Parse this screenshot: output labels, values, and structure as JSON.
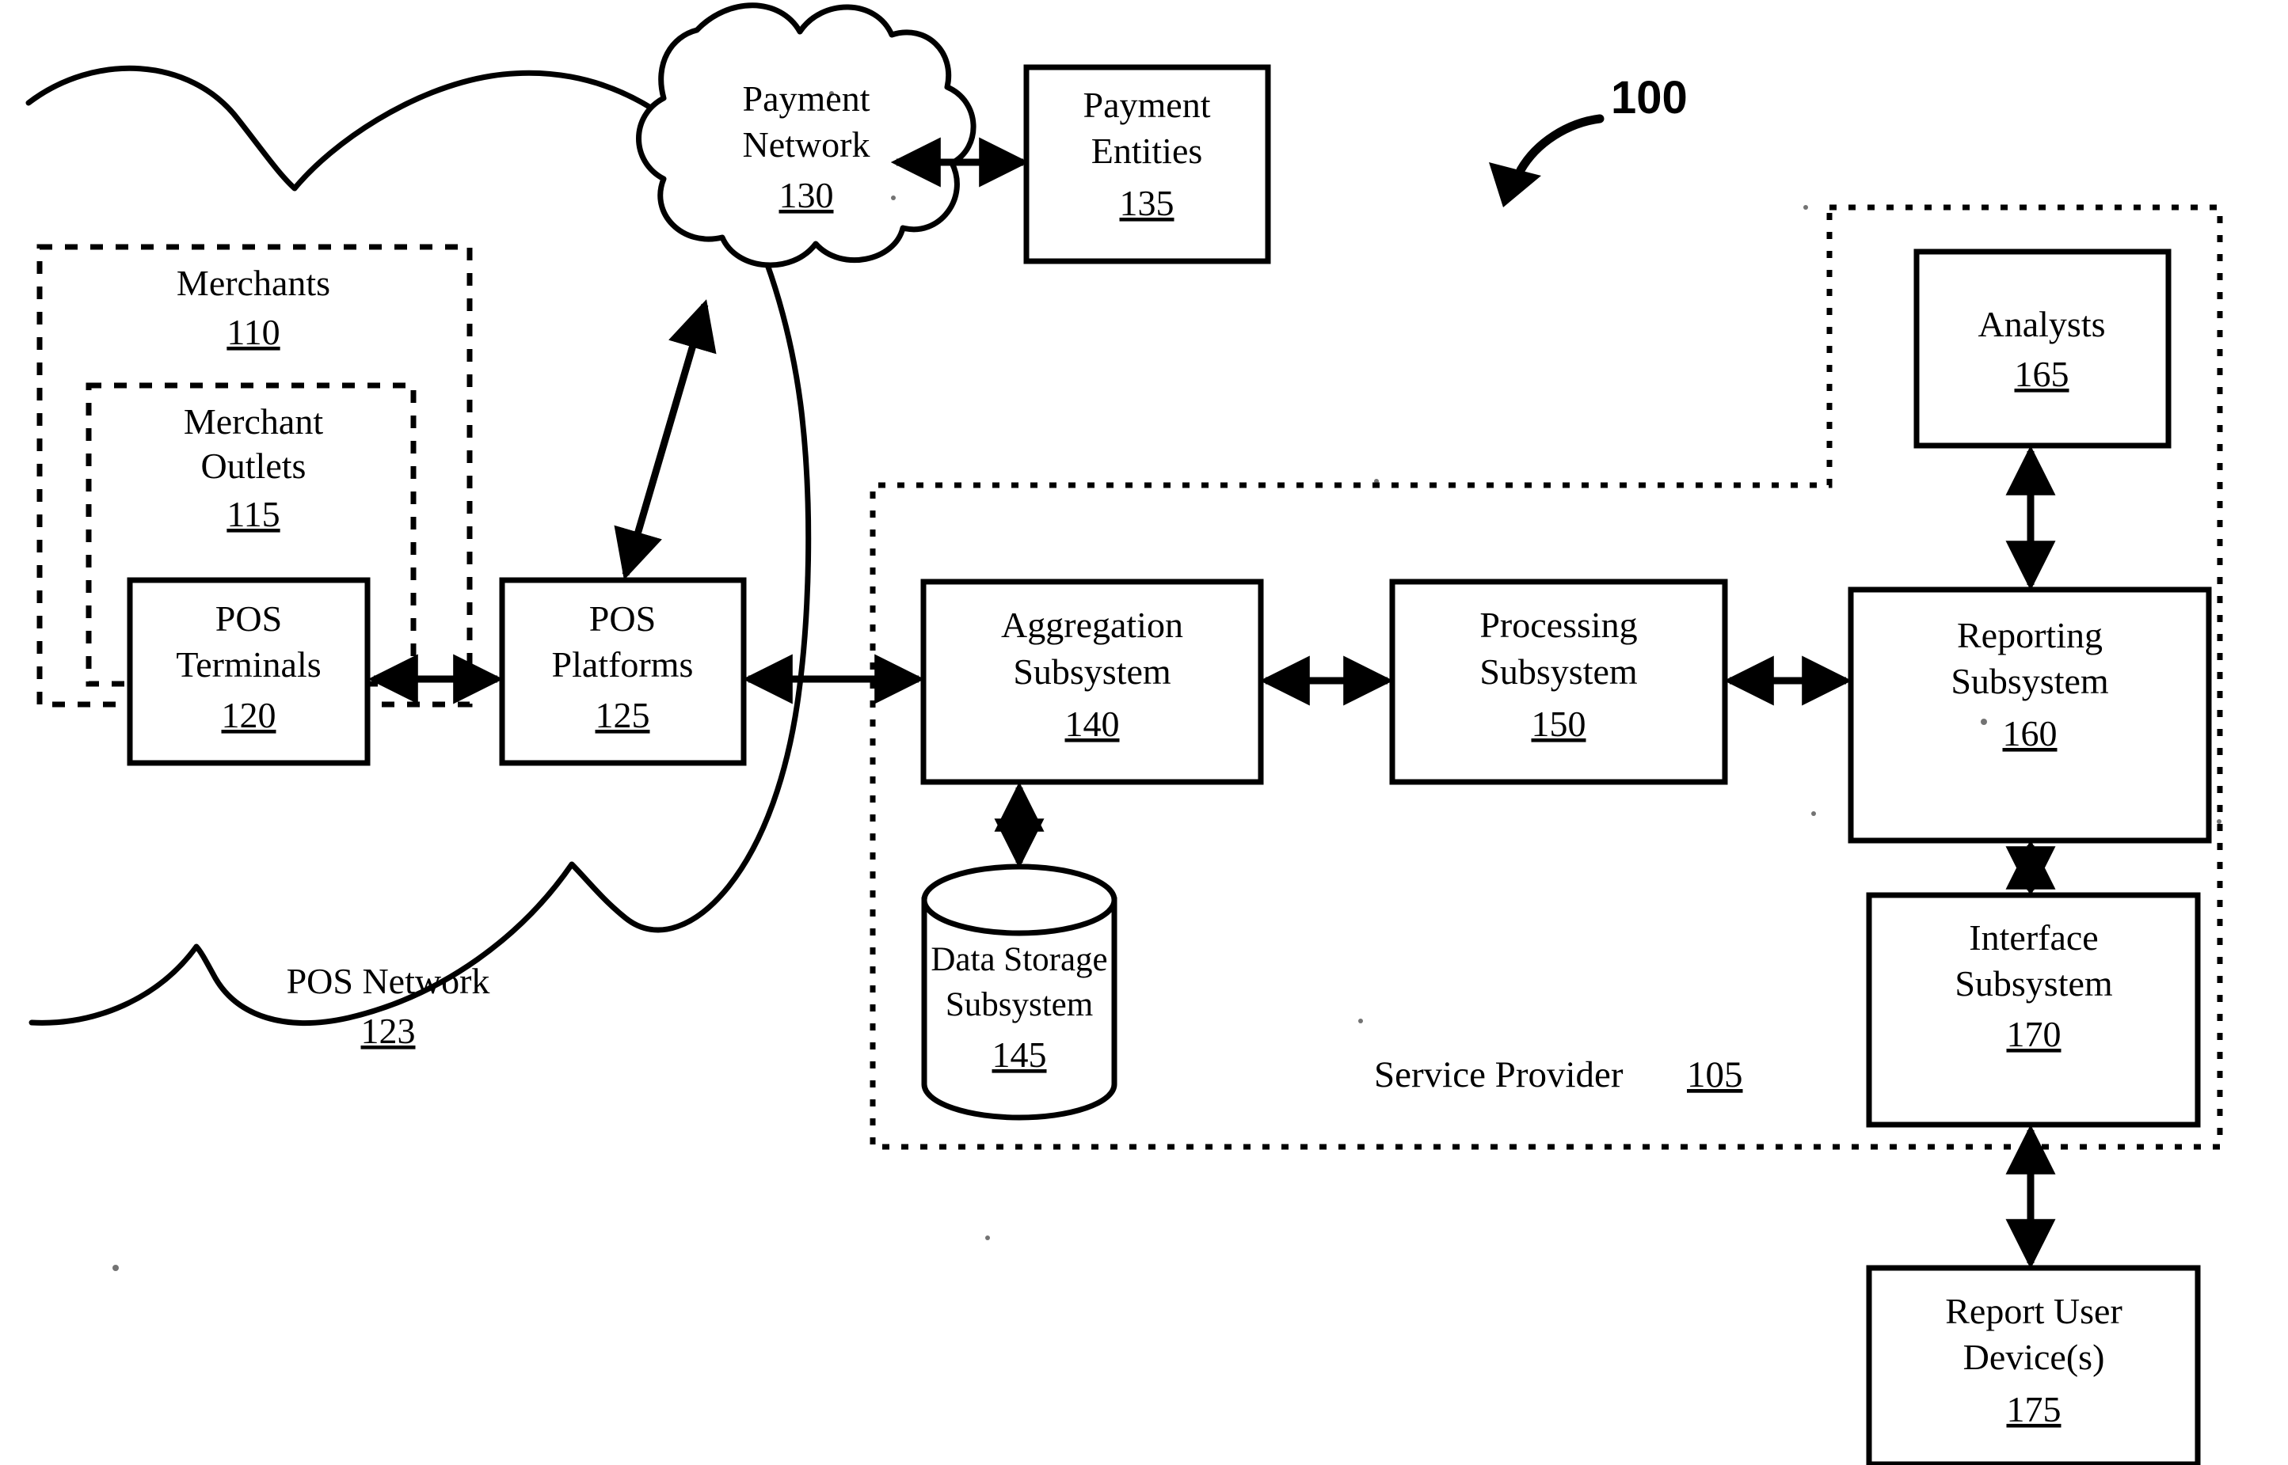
{
  "figure": {
    "number": "100",
    "type": "system-block-diagram"
  },
  "groups": [
    {
      "id": "merchants",
      "label": "Merchants",
      "ref": "110",
      "style": "dashed"
    },
    {
      "id": "merchant-outlets",
      "label_line1": "Merchant",
      "label_line2": "Outlets",
      "ref": "115",
      "style": "dashed"
    },
    {
      "id": "service-provider",
      "label": "Service Provider",
      "ref": "105",
      "style": "dashed"
    },
    {
      "id": "pos-network",
      "label": "POS Network",
      "ref": "123",
      "style": "cloud"
    }
  ],
  "nodes": {
    "payment_network": {
      "line1": "Payment",
      "line2": "Network",
      "ref": "130",
      "shape": "cloud"
    },
    "payment_entities": {
      "line1": "Payment",
      "line2": "Entities",
      "ref": "135",
      "shape": "rect"
    },
    "pos_terminals": {
      "line1": "POS",
      "line2": "Terminals",
      "ref": "120",
      "shape": "rect"
    },
    "pos_platforms": {
      "line1": "POS",
      "line2": "Platforms",
      "ref": "125",
      "shape": "rect"
    },
    "aggregation_subsystem": {
      "line1": "Aggregation",
      "line2": "Subsystem",
      "ref": "140",
      "shape": "rect"
    },
    "data_storage_subsystem": {
      "line1": "Data Storage",
      "line2": "Subsystem",
      "ref": "145",
      "shape": "cylinder"
    },
    "processing_subsystem": {
      "line1": "Processing",
      "line2": "Subsystem",
      "ref": "150",
      "shape": "rect"
    },
    "reporting_subsystem": {
      "line1": "Reporting",
      "line2": "Subsystem",
      "ref": "160",
      "shape": "rect"
    },
    "analysts": {
      "line1": "Analysts",
      "line2": "",
      "ref": "165",
      "shape": "rect"
    },
    "interface_subsystem": {
      "line1": "Interface",
      "line2": "Subsystem",
      "ref": "170",
      "shape": "rect"
    },
    "report_user_devices": {
      "line1": "Report User",
      "line2": "Device(s)",
      "ref": "175",
      "shape": "rect"
    }
  },
  "connections": [
    {
      "from": "payment_network",
      "to": "payment_entities",
      "arrow": "double"
    },
    {
      "from": "pos_platforms",
      "to": "payment_network",
      "arrow": "double"
    },
    {
      "from": "pos_terminals",
      "to": "pos_platforms",
      "arrow": "double"
    },
    {
      "from": "pos_platforms",
      "to": "aggregation_subsystem",
      "arrow": "double"
    },
    {
      "from": "aggregation_subsystem",
      "to": "data_storage_subsystem",
      "arrow": "double"
    },
    {
      "from": "aggregation_subsystem",
      "to": "processing_subsystem",
      "arrow": "double"
    },
    {
      "from": "processing_subsystem",
      "to": "reporting_subsystem",
      "arrow": "double"
    },
    {
      "from": "reporting_subsystem",
      "to": "analysts",
      "arrow": "double"
    },
    {
      "from": "reporting_subsystem",
      "to": "interface_subsystem",
      "arrow": "double"
    },
    {
      "from": "interface_subsystem",
      "to": "report_user_devices",
      "arrow": "double"
    }
  ],
  "colors": {
    "ink": "#000000",
    "paper": "#ffffff"
  }
}
